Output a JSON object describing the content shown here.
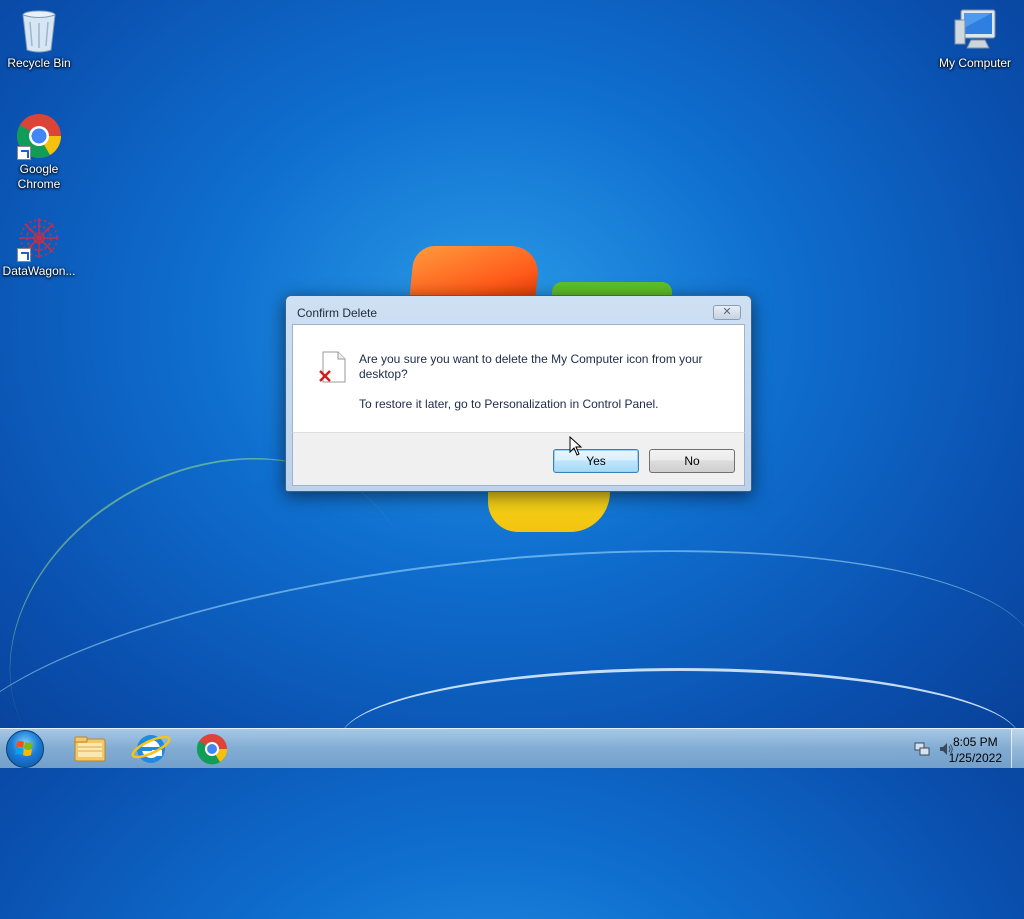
{
  "desktop": {
    "icons": [
      {
        "label": "Recycle Bin"
      },
      {
        "label": "Google Chrome"
      },
      {
        "label": "DataWagon..."
      },
      {
        "label": "My Computer"
      }
    ]
  },
  "dialog": {
    "title": "Confirm Delete",
    "close_glyph": "✕",
    "message_line1": "Are you sure you want to delete the My Computer icon from your desktop?",
    "message_line2": "To restore it later, go to Personalization in Control Panel.",
    "yes_label": "Yes",
    "no_label": "No",
    "icon": "file-delete-icon"
  },
  "taskbar": {
    "pinned": [
      {
        "name": "windows-explorer-icon"
      },
      {
        "name": "internet-explorer-icon"
      },
      {
        "name": "google-chrome-icon"
      }
    ],
    "time": "8:05 PM",
    "date": "1/25/2022"
  },
  "colors": {
    "desktop_bg": "#0f6fcf",
    "dialog_frame": "#bcd2ea",
    "yes_button": "#bee6fd",
    "taskbar": "#8cb4d7"
  }
}
